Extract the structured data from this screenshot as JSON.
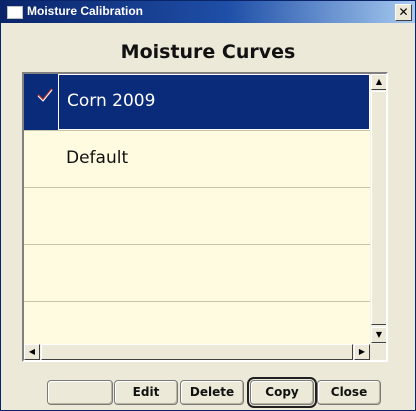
{
  "window": {
    "title": "Moisture Calibration",
    "close_glyph": "✕"
  },
  "heading": "Moisture Curves",
  "curves": [
    {
      "name": "Corn 2009",
      "selected": true,
      "checked": true,
      "check_icon": "checkmark-icon"
    },
    {
      "name": "Default",
      "selected": false,
      "checked": false
    },
    {
      "name": "",
      "selected": false,
      "checked": false
    },
    {
      "name": "",
      "selected": false,
      "checked": false
    },
    {
      "name": "",
      "selected": false,
      "checked": false
    }
  ],
  "buttons": {
    "blank": "",
    "edit": "Edit",
    "delete": "Delete",
    "copy": "Copy",
    "close": "Close"
  },
  "colors": {
    "selection": "#0a2a7a",
    "list_background": "#fffbe0",
    "check": "#c0392b"
  }
}
